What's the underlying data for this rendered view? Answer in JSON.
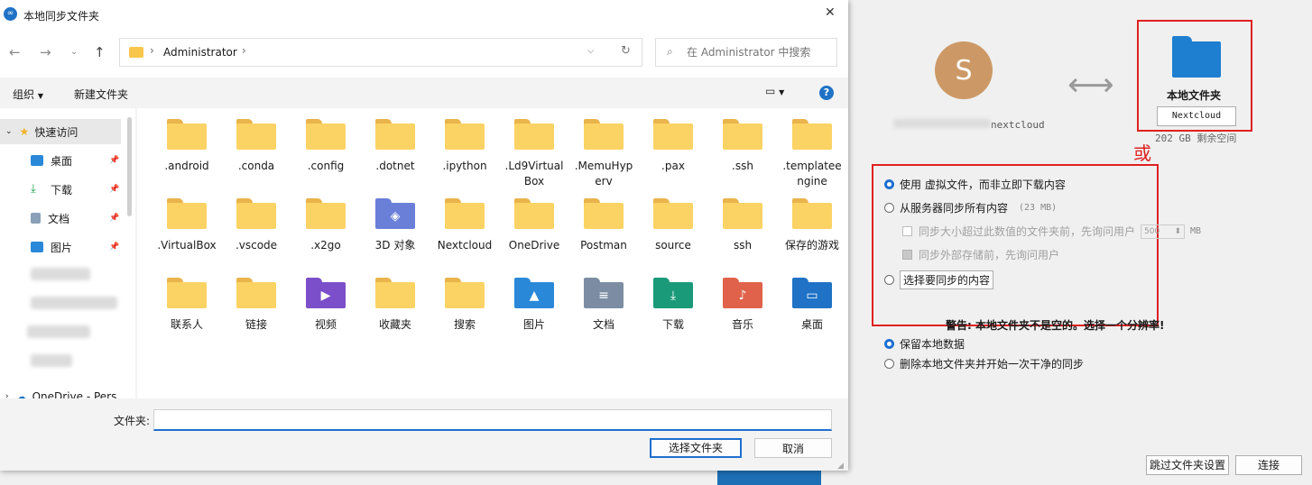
{
  "wizard": {
    "account_initial": "S",
    "account_suffix": "nextcloud",
    "local_folder_title": "本地文件夹",
    "folder_button": "Nextcloud",
    "free_space": "202 GB 剩余空间",
    "or_annotation": "或",
    "options": {
      "virtual_files": "使用 虚拟文件，而非立即下载内容",
      "sync_all": "从服务器同步所有内容",
      "sync_all_size": "(23 MB)",
      "ask_size_pre": "同步大小超过此数值的文件夹前，先询问用户",
      "ask_size_value": "500",
      "ask_size_unit": "MB",
      "ask_external": "同步外部存储前，先询问用户",
      "choose_content": "选择要同步的内容"
    },
    "warning": "警告: 本地文件夹不是空的。选择一个分辨率!",
    "keep_local": "保留本地数据",
    "erase_local": "删除本地文件夹并开始一次干净的同步",
    "skip_button": "跳过文件夹设置",
    "connect_button": "连接",
    "accent": "#1e7fd0",
    "annotation_color": "#e02020"
  },
  "dialog": {
    "title": "本地同步文件夹",
    "address": "Administrator",
    "search_placeholder": "在 Administrator 中搜索",
    "toolbar": {
      "organize": "组织",
      "new_folder": "新建文件夹"
    },
    "nav": {
      "quick_access": "快速访问",
      "desktop": "桌面",
      "downloads": "下载",
      "documents": "文档",
      "pictures": "图片",
      "onedrive": "OneDrive - Pers"
    },
    "items": [
      {
        "label": ".android",
        "icon": "folder"
      },
      {
        "label": ".conda",
        "icon": "folder"
      },
      {
        "label": ".config",
        "icon": "folder"
      },
      {
        "label": ".dotnet",
        "icon": "folder"
      },
      {
        "label": ".ipython",
        "icon": "folder"
      },
      {
        "label": ".Ld9VirtualBox",
        "icon": "folder"
      },
      {
        "label": ".MemuHyperv",
        "icon": "folder"
      },
      {
        "label": ".pax",
        "icon": "folder"
      },
      {
        "label": ".ssh",
        "icon": "folder"
      },
      {
        "label": ".templateengine",
        "icon": "folder"
      },
      {
        "label": ".VirtualBox",
        "icon": "folder"
      },
      {
        "label": ".vscode",
        "icon": "folder"
      },
      {
        "label": ".x2go",
        "icon": "folder"
      },
      {
        "label": "3D 对象",
        "icon": "3d-objects"
      },
      {
        "label": "Nextcloud",
        "icon": "folder"
      },
      {
        "label": "OneDrive",
        "icon": "folder"
      },
      {
        "label": "Postman",
        "icon": "folder"
      },
      {
        "label": "source",
        "icon": "folder"
      },
      {
        "label": "ssh",
        "icon": "folder"
      },
      {
        "label": "保存的游戏",
        "icon": "folder"
      },
      {
        "label": "联系人",
        "icon": "folder"
      },
      {
        "label": "链接",
        "icon": "folder"
      },
      {
        "label": "视频",
        "icon": "videos"
      },
      {
        "label": "收藏夹",
        "icon": "folder"
      },
      {
        "label": "搜索",
        "icon": "folder"
      },
      {
        "label": "图片",
        "icon": "pictures"
      },
      {
        "label": "文档",
        "icon": "documents"
      },
      {
        "label": "下载",
        "icon": "downloads"
      },
      {
        "label": "音乐",
        "icon": "music"
      },
      {
        "label": "桌面",
        "icon": "desktop"
      }
    ],
    "filename_label": "文件夹:",
    "filename_value": "",
    "select_button": "选择文件夹",
    "cancel_button": "取消"
  }
}
